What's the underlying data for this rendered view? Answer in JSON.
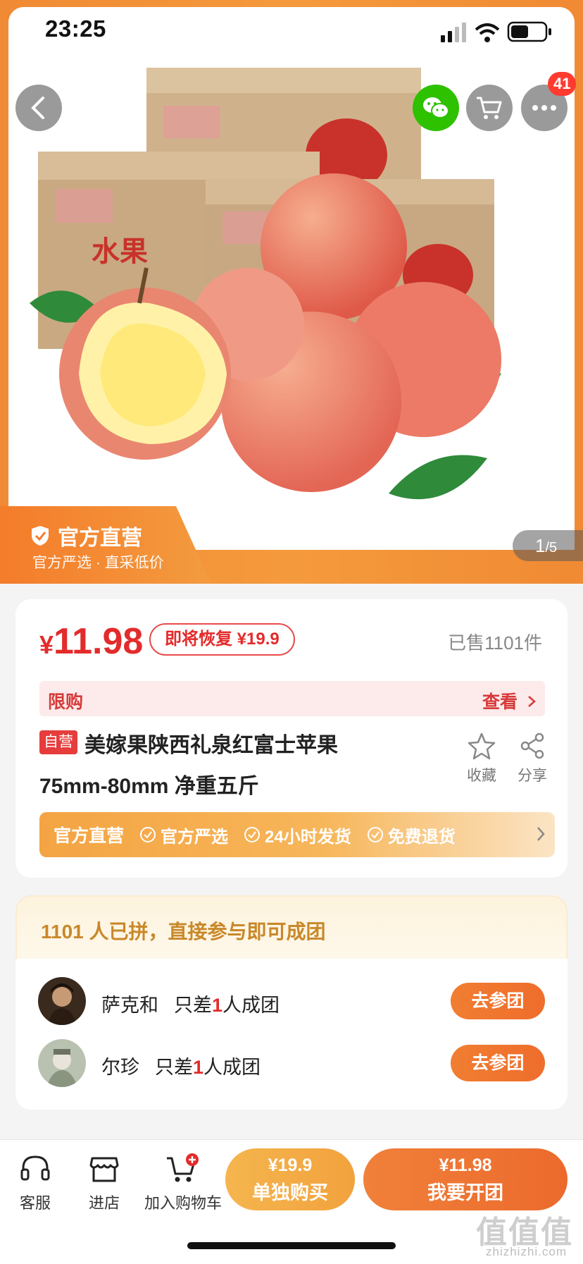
{
  "status": {
    "time": "23:25"
  },
  "nav": {
    "cart_badge": "41"
  },
  "hero": {
    "official_title": "官方直营",
    "official_sub": "官方严选 · 直采低价",
    "page_current": "1",
    "page_total": "/5",
    "box_text": "水果"
  },
  "product": {
    "price_symbol": "¥",
    "price": "11.98",
    "restore_tag": "即将恢复 ¥19.9",
    "sold": "已售1101件",
    "limit_label": "限购",
    "limit_view": "查看",
    "self_badge": "自营",
    "title_line1": "美嫁果陕西礼泉红富士苹果",
    "title_line2": "75mm-80mm 净重五斤",
    "favorite_label": "收藏",
    "share_label": "分享"
  },
  "guarantee": {
    "main": "官方直营",
    "items": [
      "官方严选",
      "24小时发货",
      "免费退货"
    ]
  },
  "group": {
    "header": "1101 人已拼，直接参与即可成团",
    "rows": [
      {
        "name": "萨克和",
        "need_prefix": "只差",
        "need_count": "1",
        "need_suffix": "人成团",
        "button": "去参团"
      },
      {
        "name": "尔珍",
        "need_prefix": "只差",
        "need_count": "1",
        "need_suffix": "人成团",
        "button": "去参团"
      }
    ]
  },
  "bottom": {
    "service": "客服",
    "store": "进店",
    "add_cart": "加入购物车",
    "single_price": "¥19.9",
    "single_label": "单独购买",
    "group_price": "¥11.98",
    "group_label": "我要开团"
  },
  "watermark": {
    "main": "值值值",
    "sub": "zhizhizhi.com"
  },
  "colors": {
    "accent": "#ef6d2b",
    "price_red": "#e32b2b",
    "gold": "#c9882a"
  }
}
